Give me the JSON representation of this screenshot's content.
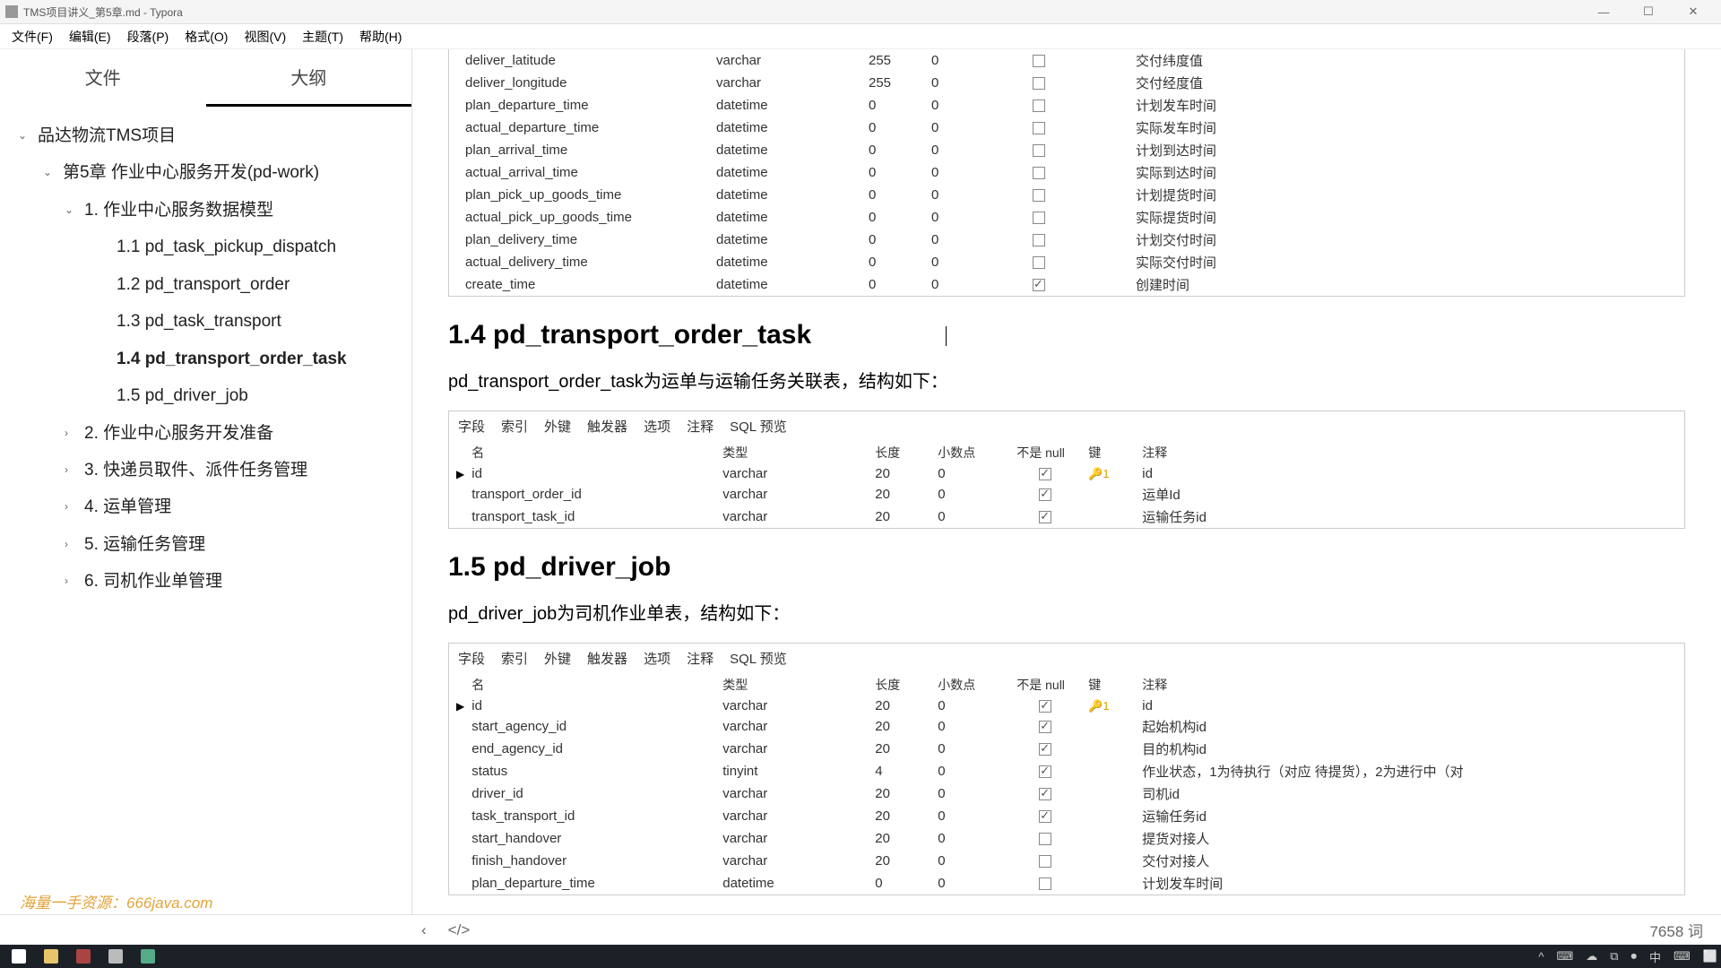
{
  "titlebar": {
    "filename": "TMS项目讲义_第5章.md",
    "app": "Typora"
  },
  "menu": [
    "文件(F)",
    "编辑(E)",
    "段落(P)",
    "格式(O)",
    "视图(V)",
    "主题(T)",
    "帮助(H)"
  ],
  "tabs": {
    "file": "文件",
    "outline": "大纲"
  },
  "tree": [
    {
      "lvl": 1,
      "caret": "open",
      "text": "品达物流TMS项目"
    },
    {
      "lvl": 2,
      "caret": "open",
      "text": "第5章 作业中心服务开发(pd-work)"
    },
    {
      "lvl": 3,
      "caret": "open",
      "text": "1. 作业中心服务数据模型"
    },
    {
      "lvl": 4,
      "caret": "none",
      "text": "1.1 pd_task_pickup_dispatch"
    },
    {
      "lvl": 4,
      "caret": "none",
      "text": "1.2 pd_transport_order"
    },
    {
      "lvl": 4,
      "caret": "none",
      "text": "1.3 pd_task_transport"
    },
    {
      "lvl": 4,
      "caret": "none",
      "text": "1.4 pd_transport_order_task",
      "active": true
    },
    {
      "lvl": 4,
      "caret": "none",
      "text": "1.5 pd_driver_job"
    },
    {
      "lvl": 3,
      "caret": "closed",
      "text": "2. 作业中心服务开发准备"
    },
    {
      "lvl": 3,
      "caret": "closed",
      "text": "3. 快递员取件、派件任务管理"
    },
    {
      "lvl": 3,
      "caret": "closed",
      "text": "4. 运单管理"
    },
    {
      "lvl": 3,
      "caret": "closed",
      "text": "5. 运输任务管理"
    },
    {
      "lvl": 3,
      "caret": "closed",
      "text": "6. 司机作业单管理"
    }
  ],
  "watermark": "海量一手资源：666java.com",
  "top_table_rows": [
    {
      "name": "deliver_latitude",
      "type": "varchar",
      "len": "255",
      "dec": "0",
      "nn": false,
      "key": "",
      "comment": "交付纬度值"
    },
    {
      "name": "deliver_longitude",
      "type": "varchar",
      "len": "255",
      "dec": "0",
      "nn": false,
      "key": "",
      "comment": "交付经度值"
    },
    {
      "name": "plan_departure_time",
      "type": "datetime",
      "len": "0",
      "dec": "0",
      "nn": false,
      "key": "",
      "comment": "计划发车时间"
    },
    {
      "name": "actual_departure_time",
      "type": "datetime",
      "len": "0",
      "dec": "0",
      "nn": false,
      "key": "",
      "comment": "实际发车时间"
    },
    {
      "name": "plan_arrival_time",
      "type": "datetime",
      "len": "0",
      "dec": "0",
      "nn": false,
      "key": "",
      "comment": "计划到达时间"
    },
    {
      "name": "actual_arrival_time",
      "type": "datetime",
      "len": "0",
      "dec": "0",
      "nn": false,
      "key": "",
      "comment": "实际到达时间"
    },
    {
      "name": "plan_pick_up_goods_time",
      "type": "datetime",
      "len": "0",
      "dec": "0",
      "nn": false,
      "key": "",
      "comment": "计划提货时间"
    },
    {
      "name": "actual_pick_up_goods_time",
      "type": "datetime",
      "len": "0",
      "dec": "0",
      "nn": false,
      "key": "",
      "comment": "实际提货时间"
    },
    {
      "name": "plan_delivery_time",
      "type": "datetime",
      "len": "0",
      "dec": "0",
      "nn": false,
      "key": "",
      "comment": "计划交付时间"
    },
    {
      "name": "actual_delivery_time",
      "type": "datetime",
      "len": "0",
      "dec": "0",
      "nn": false,
      "key": "",
      "comment": "实际交付时间"
    },
    {
      "name": "create_time",
      "type": "datetime",
      "len": "0",
      "dec": "0",
      "nn": true,
      "key": "",
      "comment": "创建时间"
    }
  ],
  "section14": {
    "heading": "1.4 pd_transport_order_task",
    "desc": "pd_transport_order_task为运单与运输任务关联表，结构如下："
  },
  "db_tabs": [
    "字段",
    "索引",
    "外键",
    "触发器",
    "选项",
    "注释",
    "SQL 预览"
  ],
  "db_headers": {
    "name": "名",
    "type": "类型",
    "len": "长度",
    "dec": "小数点",
    "nn": "不是 null",
    "key": "键",
    "comment": "注释"
  },
  "table14_rows": [
    {
      "ptr": true,
      "name": "id",
      "type": "varchar",
      "len": "20",
      "dec": "0",
      "nn": true,
      "key": "🔑1",
      "comment": "id"
    },
    {
      "ptr": false,
      "name": "transport_order_id",
      "type": "varchar",
      "len": "20",
      "dec": "0",
      "nn": true,
      "key": "",
      "comment": "运单Id"
    },
    {
      "ptr": false,
      "name": "transport_task_id",
      "type": "varchar",
      "len": "20",
      "dec": "0",
      "nn": true,
      "key": "",
      "comment": "运输任务id"
    }
  ],
  "section15": {
    "heading": "1.5 pd_driver_job",
    "desc": "pd_driver_job为司机作业单表，结构如下："
  },
  "table15_rows": [
    {
      "ptr": true,
      "name": "id",
      "type": "varchar",
      "len": "20",
      "dec": "0",
      "nn": true,
      "key": "🔑1",
      "comment": "id"
    },
    {
      "ptr": false,
      "name": "start_agency_id",
      "type": "varchar",
      "len": "20",
      "dec": "0",
      "nn": true,
      "key": "",
      "comment": "起始机构id"
    },
    {
      "ptr": false,
      "name": "end_agency_id",
      "type": "varchar",
      "len": "20",
      "dec": "0",
      "nn": true,
      "key": "",
      "comment": "目的机构id"
    },
    {
      "ptr": false,
      "name": "status",
      "type": "tinyint",
      "len": "4",
      "dec": "0",
      "nn": true,
      "key": "",
      "comment": "作业状态，1为待执行（对应 待提货），2为进行中（对"
    },
    {
      "ptr": false,
      "name": "driver_id",
      "type": "varchar",
      "len": "20",
      "dec": "0",
      "nn": true,
      "key": "",
      "comment": "司机id"
    },
    {
      "ptr": false,
      "name": "task_transport_id",
      "type": "varchar",
      "len": "20",
      "dec": "0",
      "nn": true,
      "key": "",
      "comment": "运输任务id"
    },
    {
      "ptr": false,
      "name": "start_handover",
      "type": "varchar",
      "len": "20",
      "dec": "0",
      "nn": false,
      "key": "",
      "comment": "提货对接人"
    },
    {
      "ptr": false,
      "name": "finish_handover",
      "type": "varchar",
      "len": "20",
      "dec": "0",
      "nn": false,
      "key": "",
      "comment": "交付对接人"
    },
    {
      "ptr": false,
      "name": "plan_departure_time",
      "type": "datetime",
      "len": "0",
      "dec": "0",
      "nn": false,
      "key": "",
      "comment": "计划发车时间"
    }
  ],
  "status": {
    "back": "‹",
    "source": "</> ",
    "words": "7658 词"
  },
  "tray": [
    "^",
    "⌨",
    "☁",
    "⧉",
    "⏺",
    "中",
    "⌨",
    "⬜"
  ]
}
